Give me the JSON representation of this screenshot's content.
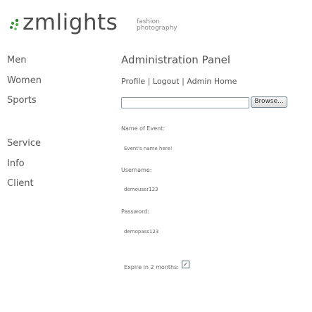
{
  "logo": {
    "name": "zmlights",
    "tagline_line1": "fashion",
    "tagline_line2": "photography",
    "icon": "leaf-dots-icon",
    "accent_color": "#3a8a3a"
  },
  "sidebar": {
    "items": [
      {
        "label": "Men"
      },
      {
        "label": "Women"
      },
      {
        "label": "Sports"
      },
      {
        "label": "Service"
      },
      {
        "label": "Info"
      },
      {
        "label": "Client"
      }
    ]
  },
  "main": {
    "title": "Administration Panel",
    "nav": {
      "profile": "Profile",
      "logout": "Logout",
      "admin_home": "Admin Home",
      "separator": "|"
    },
    "upload": {
      "browse_label": "Browse..."
    },
    "form": {
      "event_label": "Name of Event:",
      "event_value": "Event's name here!",
      "username_label": "Username:",
      "username_value": "demouser123",
      "password_label": "Password:",
      "password_value": "demopass123",
      "expire_label": "Expire in 2 months:",
      "expire_checked": true
    }
  }
}
